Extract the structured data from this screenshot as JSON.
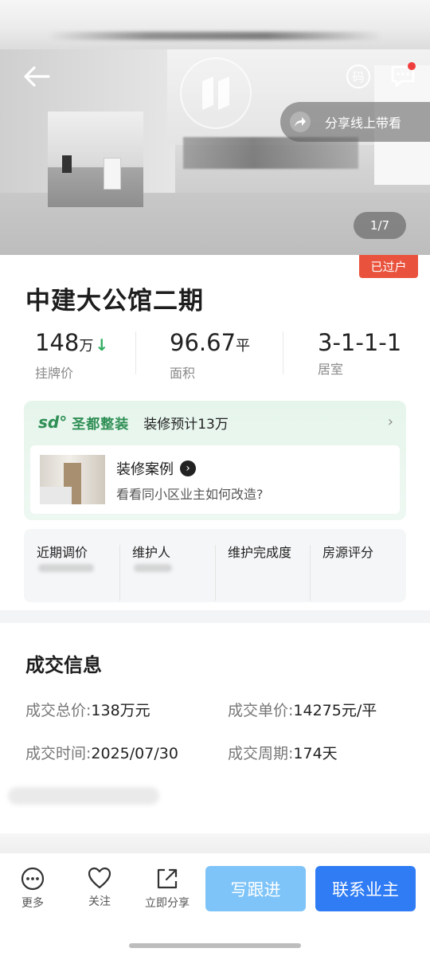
{
  "hero": {
    "share_label": "分享线上带看",
    "qr_label": "码",
    "page_indicator": "1/7"
  },
  "listing": {
    "status_badge": "已过户",
    "title": "中建大公馆二期",
    "stats": {
      "price_value": "148",
      "price_unit": "万",
      "price_label": "挂牌价",
      "area_value": "96.67",
      "area_unit": "平",
      "area_label": "面积",
      "layout_value": "3-1-1-1",
      "layout_label": "居室"
    }
  },
  "renovation": {
    "logo_mark": "sd°",
    "brand": "圣都整装",
    "budget": "装修预计13万",
    "case_title": "装修案例",
    "case_subtitle": "看看同小区业主如何改造?"
  },
  "metrics": [
    "近期调价",
    "维护人",
    "维护完成度",
    "房源评分"
  ],
  "deal": {
    "title": "成交信息",
    "total_price_label": "成交总价:",
    "total_price_value": "138万元",
    "unit_price_label": "成交单价:",
    "unit_price_value": "14275元/平",
    "date_label": "成交时间:",
    "date_value": "2025/07/30",
    "cycle_label": "成交周期:",
    "cycle_value": "174天"
  },
  "bottom_bar": {
    "more_label": "更多",
    "follow_label": "关注",
    "share_label": "立即分享",
    "follow_up_button": "写跟进",
    "contact_button": "联系业主"
  },
  "colors": {
    "accent_blue": "#2f7cf5",
    "light_blue": "#7ec4f8",
    "badge_red": "#e9533e",
    "price_down_green": "#2fae60",
    "brand_green": "#2f8f55"
  }
}
